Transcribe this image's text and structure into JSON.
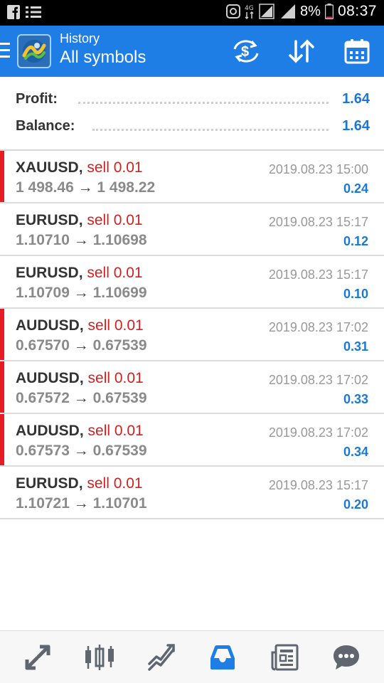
{
  "status_bar": {
    "network_type": "4G",
    "battery_percent": "8%",
    "time": "08:37"
  },
  "app_bar": {
    "subtitle": "History",
    "title": "All symbols",
    "accent_color": "#1e7ee6"
  },
  "summary": {
    "profit_label": "Profit:",
    "profit_value": "1.64",
    "balance_label": "Balance:",
    "balance_value": "1.64"
  },
  "trades": [
    {
      "symbol": "XAUUSD",
      "type": "sell 0.01",
      "open": "1 498.46",
      "close": "1 498.22",
      "time": "2019.08.23 15:00",
      "profit": "0.24",
      "marked": true
    },
    {
      "symbol": "EURUSD",
      "type": "sell 0.01",
      "open": "1.10710",
      "close": "1.10698",
      "time": "2019.08.23 15:17",
      "profit": "0.12",
      "marked": false
    },
    {
      "symbol": "EURUSD",
      "type": "sell 0.01",
      "open": "1.10709",
      "close": "1.10699",
      "time": "2019.08.23 15:17",
      "profit": "0.10",
      "marked": false
    },
    {
      "symbol": "AUDUSD",
      "type": "sell 0.01",
      "open": "0.67570",
      "close": "0.67539",
      "time": "2019.08.23 17:02",
      "profit": "0.31",
      "marked": true
    },
    {
      "symbol": "AUDUSD",
      "type": "sell 0.01",
      "open": "0.67572",
      "close": "0.67539",
      "time": "2019.08.23 17:02",
      "profit": "0.33",
      "marked": true
    },
    {
      "symbol": "AUDUSD",
      "type": "sell 0.01",
      "open": "0.67573",
      "close": "0.67539",
      "time": "2019.08.23 17:02",
      "profit": "0.34",
      "marked": true
    },
    {
      "symbol": "EURUSD",
      "type": "sell 0.01",
      "open": "1.10721",
      "close": "1.10701",
      "time": "2019.08.23 15:17",
      "profit": "0.20",
      "marked": false
    }
  ],
  "bottom_nav": {
    "items": [
      "quotes-icon",
      "chart-icon",
      "trade-icon",
      "history-icon",
      "news-icon",
      "chat-icon"
    ],
    "active": "history-icon",
    "active_color": "#1e7ee6",
    "inactive_color": "#5f6670"
  },
  "colors": {
    "sell": "#d32020",
    "profit": "#1a78d6",
    "marker": "#e51c23"
  }
}
